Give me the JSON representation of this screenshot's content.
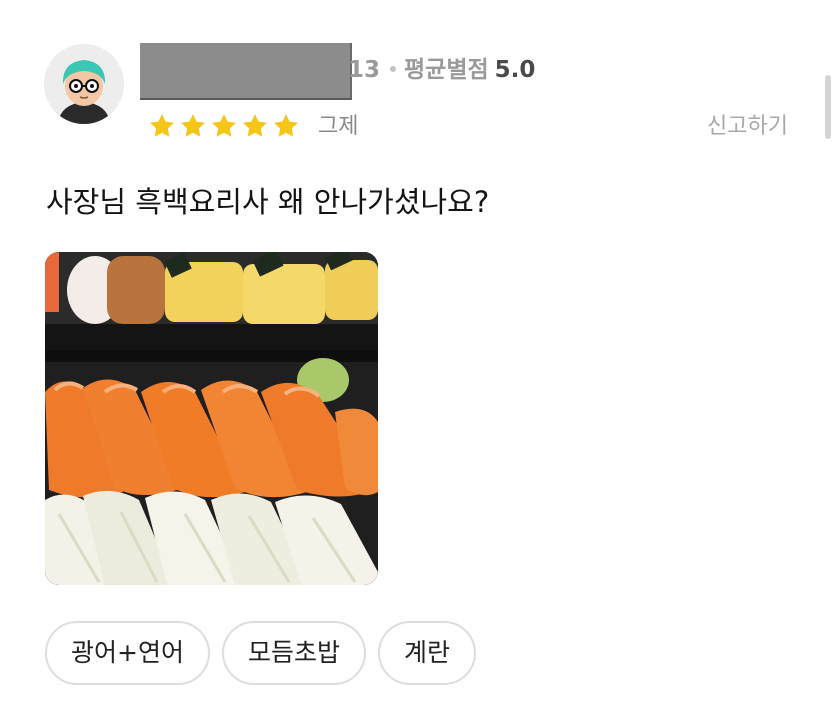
{
  "review": {
    "author": {
      "count_suffix": "13",
      "rating_label": "평균별점",
      "rating_value": "5.0",
      "avatar": "avatar-teal-hair-glasses"
    },
    "stars": {
      "filled": 5,
      "total": 5,
      "color": "#f5c518"
    },
    "stars_caption": "그제",
    "report_label": "신고하기",
    "text": "사장님 흑백요리사 왜 안나가셨나요?",
    "photo": "sushi-photo",
    "menu_items": [
      "광어+연어",
      "모듬초밥",
      "계란"
    ]
  },
  "colors": {
    "star": "#f5c518",
    "muted_text": "#9a9a9a",
    "chip_border": "#dddddd",
    "redaction": "#8c8c8c"
  }
}
